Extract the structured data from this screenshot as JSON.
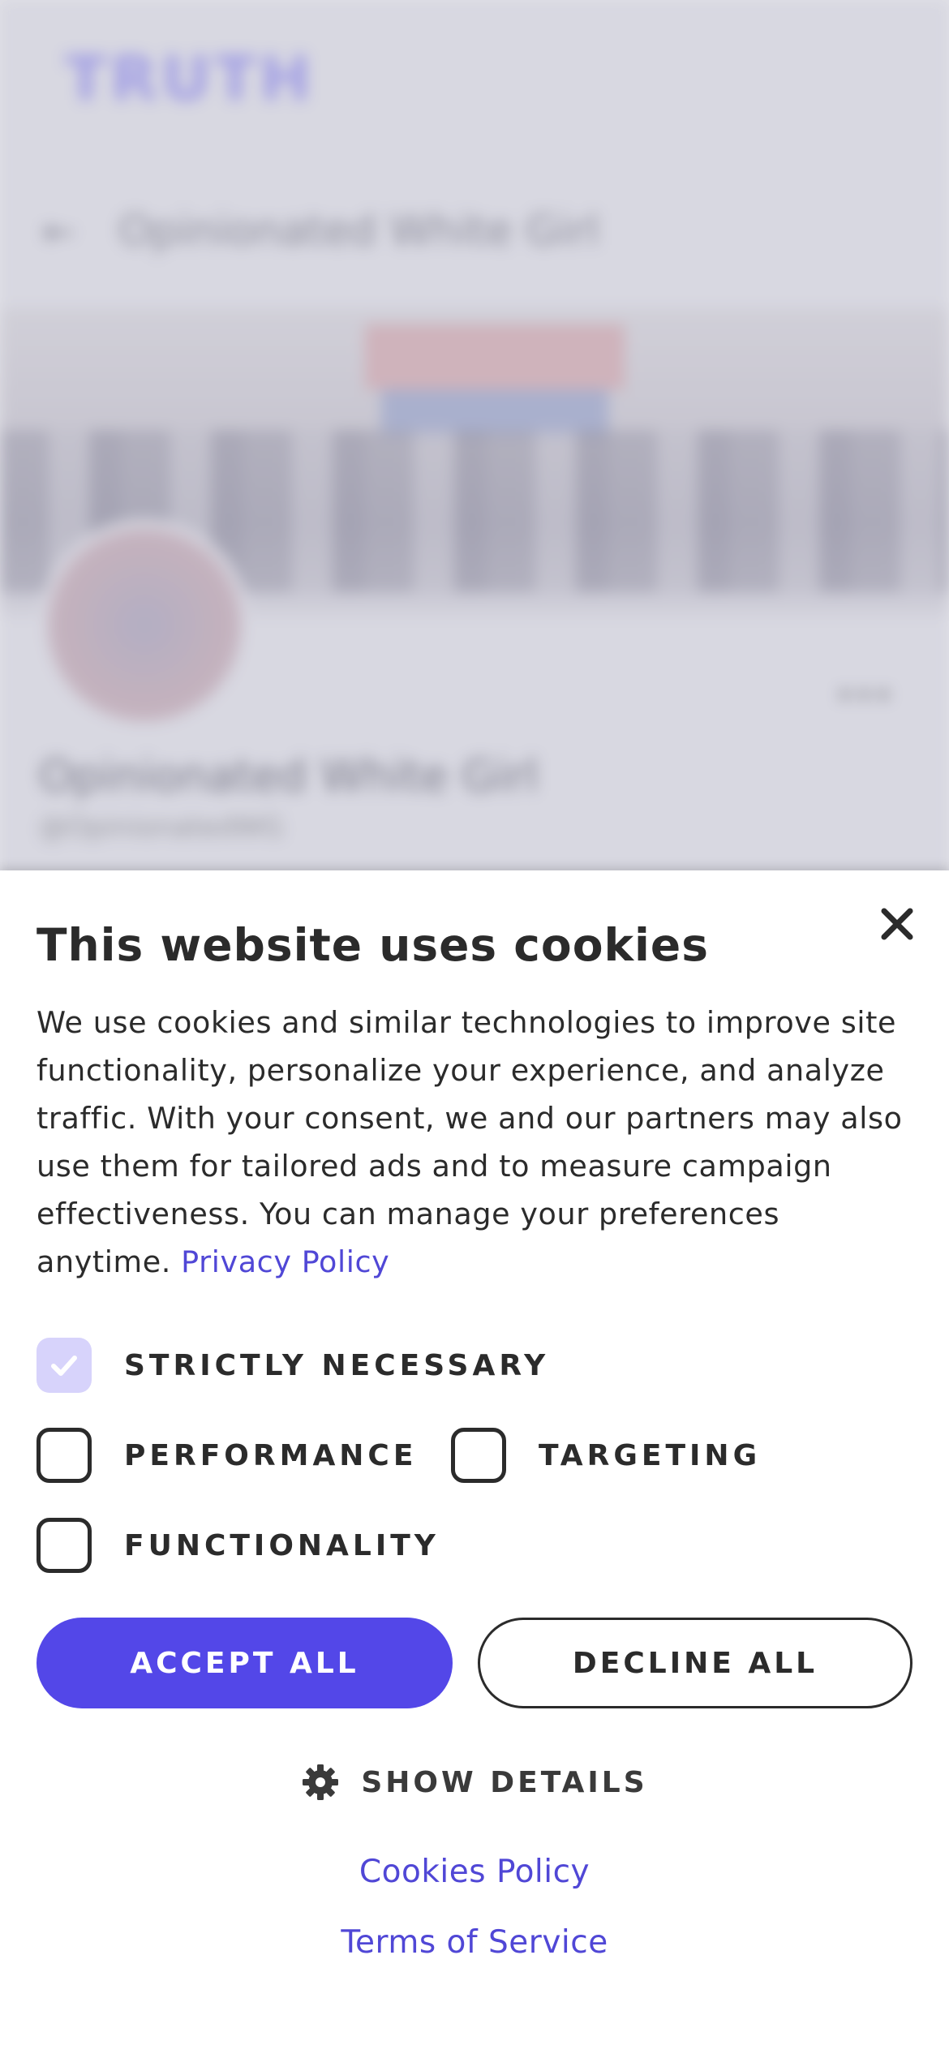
{
  "background": {
    "logo": "TRUTH",
    "header_title": "Opinionated White Girl",
    "profile_name": "Opinionated White Girl",
    "profile_handle": "@OpinionatedWG",
    "more": "•••"
  },
  "cookie_banner": {
    "title": "This website uses cookies",
    "description": "We use cookies and similar technologies to improve site functionality, personalize your experience, and analyze traffic. With your consent, we and our partners may also use them for tailored ads and to measure campaign effectiveness. You can manage your preferences anytime. ",
    "privacy_link": "Privacy Policy",
    "options": {
      "strictly_necessary": {
        "label": "STRICTLY NECESSARY",
        "checked": true,
        "disabled": true
      },
      "performance": {
        "label": "PERFORMANCE",
        "checked": false
      },
      "targeting": {
        "label": "TARGETING",
        "checked": false
      },
      "functionality": {
        "label": "FUNCTIONALITY",
        "checked": false
      }
    },
    "accept_label": "ACCEPT ALL",
    "decline_label": "DECLINE ALL",
    "show_details_label": "SHOW DETAILS",
    "cookies_policy_link": "Cookies Policy",
    "terms_link": "Terms of Service"
  },
  "colors": {
    "accent": "#5347e8",
    "link": "#5047d6",
    "checked_disabled": "#d7d3fb",
    "text": "#2b2b2b"
  },
  "icons": {
    "close": "close-icon",
    "check": "check-icon",
    "gear": "gear-icon",
    "back": "back-arrow-icon"
  }
}
